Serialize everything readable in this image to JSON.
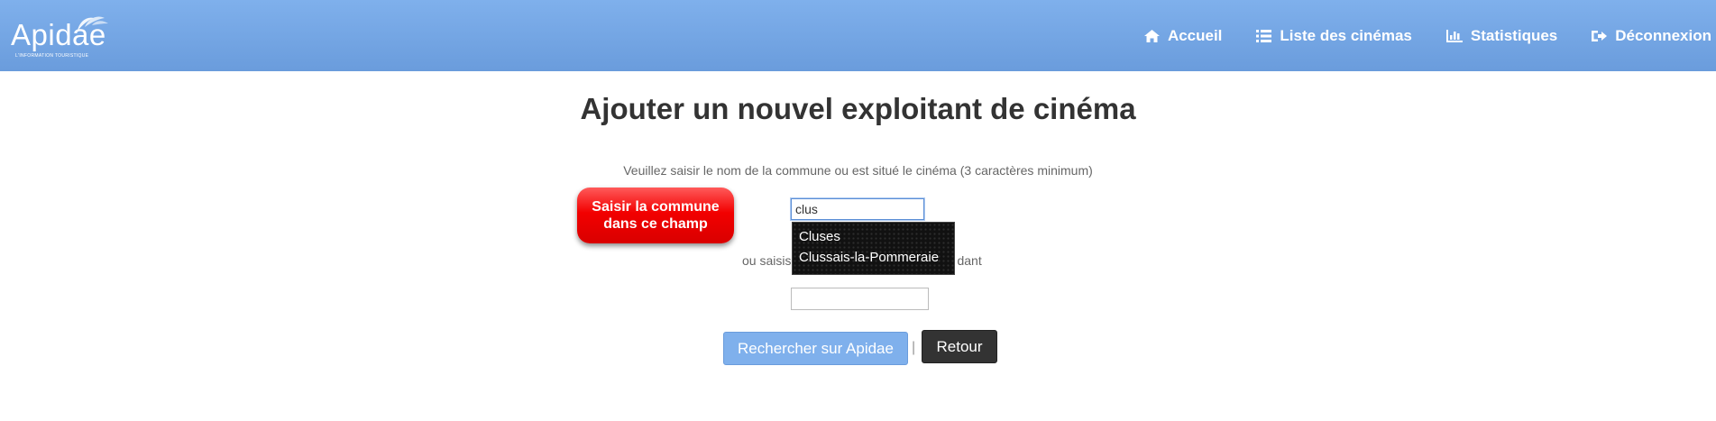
{
  "brand": {
    "name": "Apidae",
    "tagline": "L'INFORMATION TOURISTIQUE"
  },
  "nav": {
    "items": [
      {
        "label": "Accueil",
        "icon": "home-icon"
      },
      {
        "label": "Liste des cinémas",
        "icon": "list-icon"
      },
      {
        "label": "Statistiques",
        "icon": "bar-chart-icon"
      },
      {
        "label": "Déconnexion",
        "icon": "logout-icon"
      }
    ]
  },
  "main": {
    "title": "Ajouter un nouvel exploitant de cinéma",
    "help_text": "Veuillez saisir le nom de la commune ou est situé le cinéma (3 caractères minimum)",
    "commune_value": "clus",
    "or_text": "ou saisis",
    "or_text_tail": "dant",
    "autocomplete": [
      "Cluses",
      "Clussais-la-Pommeraie"
    ],
    "search_button": "Rechercher sur Apidae",
    "separator": "|",
    "back_button": "Retour"
  },
  "callout": {
    "text": "Saisir la commune dans ce champ"
  },
  "colors": {
    "navbar": "#7fb0ec",
    "primary_button": "#7fb0ec",
    "dark_button": "#333333",
    "callout": "#f20000"
  }
}
